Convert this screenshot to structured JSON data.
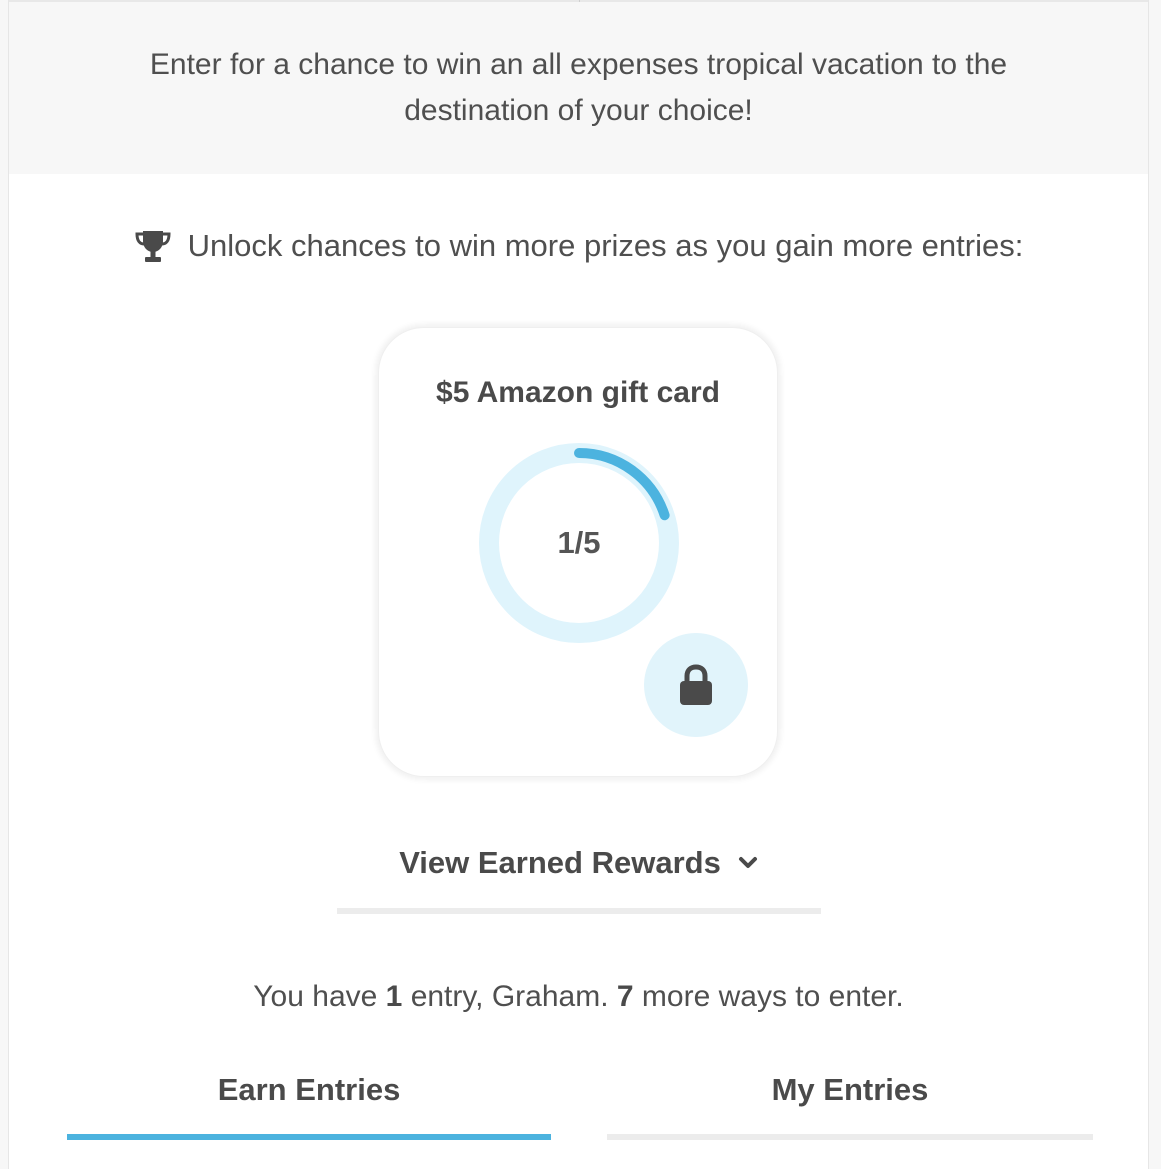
{
  "intro": {
    "text": "Enter for a chance to win an all expenses tropical vacation to the destination of your choice!"
  },
  "unlock": {
    "icon": "trophy-icon",
    "text": "Unlock chances to win more prizes as you gain more entries:"
  },
  "reward_card": {
    "prize": "$5 Amazon gift card",
    "progress_label": "1/5",
    "progress_current": 1,
    "progress_total": 5,
    "status_icon": "lock-icon",
    "ring_track_color": "#dff4fc",
    "ring_fill_color": "#4cb3df",
    "lock_badge_color": "#e1f4fb"
  },
  "earned_rewards": {
    "label": "View Earned Rewards",
    "icon": "chevron-down-icon"
  },
  "status": {
    "prefix": "You have",
    "entries": "1",
    "entries_suffix": "entry, Graham.",
    "ways": "7",
    "ways_suffix": "more ways to enter."
  },
  "tabs": [
    {
      "label": "Earn Entries",
      "active": true
    },
    {
      "label": "My Entries",
      "active": false
    }
  ],
  "colors": {
    "accent": "#4cb3df",
    "text": "#4a4a4a",
    "intro_background": "#f7f7f7"
  }
}
